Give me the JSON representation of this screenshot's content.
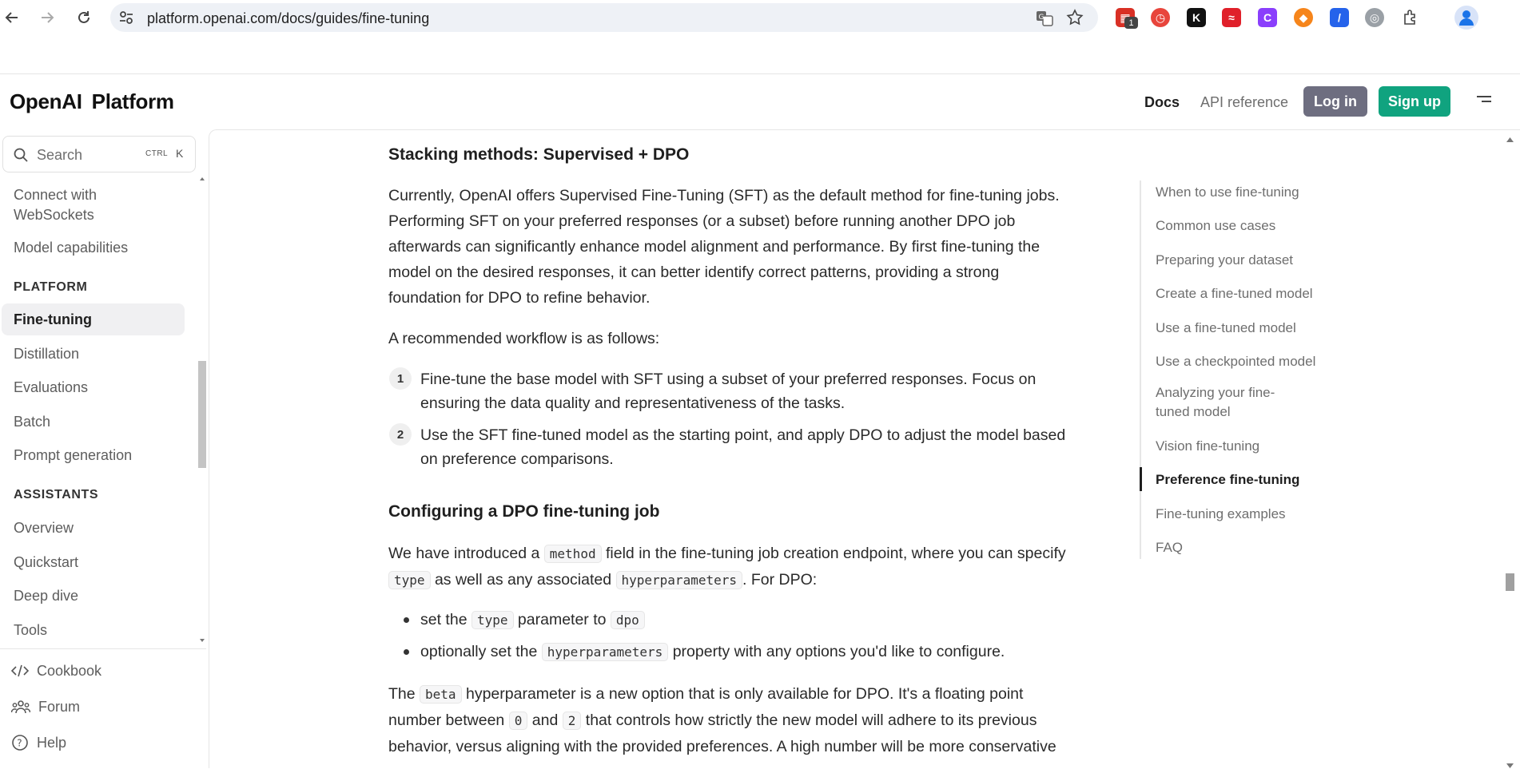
{
  "browser": {
    "url": "platform.openai.com/docs/guides/fine-tuning",
    "extension_badge": "1"
  },
  "header": {
    "brand_part1": "OpenAI",
    "brand_part2": "Platform",
    "docs_label": "Docs",
    "api_reference_label": "API reference",
    "login_label": "Log in",
    "signup_label": "Sign up"
  },
  "sidebar": {
    "search_label": "Search",
    "shortcut_mod": "CTRL",
    "shortcut_key": "K",
    "items_top": [
      "Connect with",
      "WebSockets",
      "Model capabilities"
    ],
    "platform_heading": "PLATFORM",
    "platform_items": [
      "Fine-tuning",
      "Distillation",
      "Evaluations",
      "Batch",
      "Prompt generation"
    ],
    "assistants_heading": "ASSISTANTS",
    "assistants_items": [
      "Overview",
      "Quickstart",
      "Deep dive",
      "Tools"
    ],
    "footer": [
      "Cookbook",
      "Forum",
      "Help"
    ]
  },
  "content": {
    "heading_stacking": "Stacking methods: Supervised + DPO",
    "para1_lines": [
      "Currently, OpenAI offers Supervised Fine-Tuning (SFT) as the default method for fine-tuning jobs.",
      "Performing SFT on your preferred responses (or a subset) before running another DPO job",
      "afterwards can significantly enhance model alignment and performance. By first fine-tuning the",
      "model on the desired responses, it can better identify correct patterns, providing a strong",
      "foundation for DPO to refine behavior."
    ],
    "para2": "A recommended workflow is as follows:",
    "steps": [
      {
        "num": "1",
        "line1": "Fine-tune the base model with SFT using a subset of your preferred responses. Focus on",
        "line2": "ensuring the data quality and representativeness of the tasks."
      },
      {
        "num": "2",
        "line1": "Use the SFT fine-tuned model as the starting point, and apply DPO to adjust the model based",
        "line2": "on preference comparisons."
      }
    ],
    "heading_config": "Configuring a DPO fine-tuning job",
    "config_l1_a": "We have introduced a",
    "config_l1_code": "method",
    "config_l1_b": "field in the fine-tuning job creation endpoint, where you can specify",
    "config_l2_code1": "type",
    "config_l2_a": "as well as any associated",
    "config_l2_code2": "hyperparameters",
    "config_l2_b": ". For DPO:",
    "bullet1_a": "set the",
    "bullet1_code1": "type",
    "bullet1_b": "parameter to",
    "bullet1_code2": "dpo",
    "bullet2_a": "optionally set the",
    "bullet2_code": "hyperparameters",
    "bullet2_b": "property with any options you'd like to configure.",
    "beta_l1_a": "The",
    "beta_l1_code": "beta",
    "beta_l1_b": "hyperparameter is a new option that is only available for DPO. It's a floating point",
    "beta_l2_a": "number between",
    "beta_l2_code1": "0",
    "beta_l2_b": "and",
    "beta_l2_code2": "2",
    "beta_l2_c": "that controls how strictly the new model will adhere to its previous",
    "beta_l3": "behavior, versus aligning with the provided preferences. A high number will be more conservative"
  },
  "toc": {
    "items": [
      "When to use fine-tuning",
      "Common use cases",
      "Preparing your dataset",
      "Create a fine-tuned model",
      "Use a fine-tuned model",
      "Use a checkpointed model",
      "Analyzing your fine-",
      "tuned model",
      "Vision fine-tuning",
      "Preference fine-tuning",
      "Fine-tuning examples",
      "FAQ"
    ]
  }
}
